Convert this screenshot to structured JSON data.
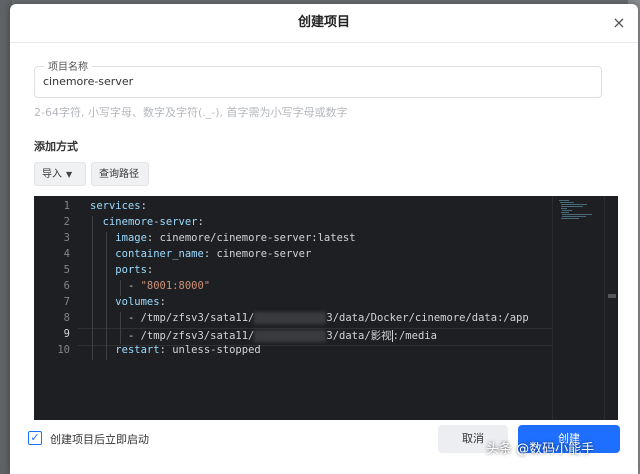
{
  "dialog": {
    "title": "创建项目",
    "close_icon": "×"
  },
  "project_name": {
    "label": "项目名称",
    "value": "cinemore-server",
    "hint": "2-64字符, 小写字母、数字及字符(._-), 首字需为小写字母或数字"
  },
  "add_method": {
    "label": "添加方式",
    "import_button": "导入",
    "query_path_button": "查询路径"
  },
  "editor": {
    "line_numbers": [
      "1",
      "2",
      "3",
      "4",
      "5",
      "6",
      "7",
      "8",
      "9",
      "10"
    ],
    "lines": {
      "l1_key": "services",
      "l2_key": "cinemore-server",
      "l3_key": "image",
      "l3_val": "cinemore/cinemore-server:latest",
      "l4_key": "container_name",
      "l4_val": "cinemore-server",
      "l5_key": "ports",
      "l6_val": "\"8001:8000\"",
      "l7_key": "volumes",
      "l8_val_a": "/tmp/zfsv3/sata11/",
      "l8_val_b": "3/data/Docker/cinemore/data:/app",
      "l9_val_a": "/tmp/zfsv3/sata11/",
      "l9_val_b": "3/data/影视",
      "l9_val_c": ":/media",
      "l10_key": "restart",
      "l10_val": "unless-stopped"
    },
    "active_line": "9"
  },
  "footer": {
    "autostart_checked": true,
    "autostart_label": "创建项目后立即启动",
    "cancel_button": "取消",
    "create_button": "创建"
  },
  "watermark": "头条 @数码小能手",
  "colors": {
    "primary": "#1e6fff",
    "editor_bg": "#1e1f22"
  }
}
